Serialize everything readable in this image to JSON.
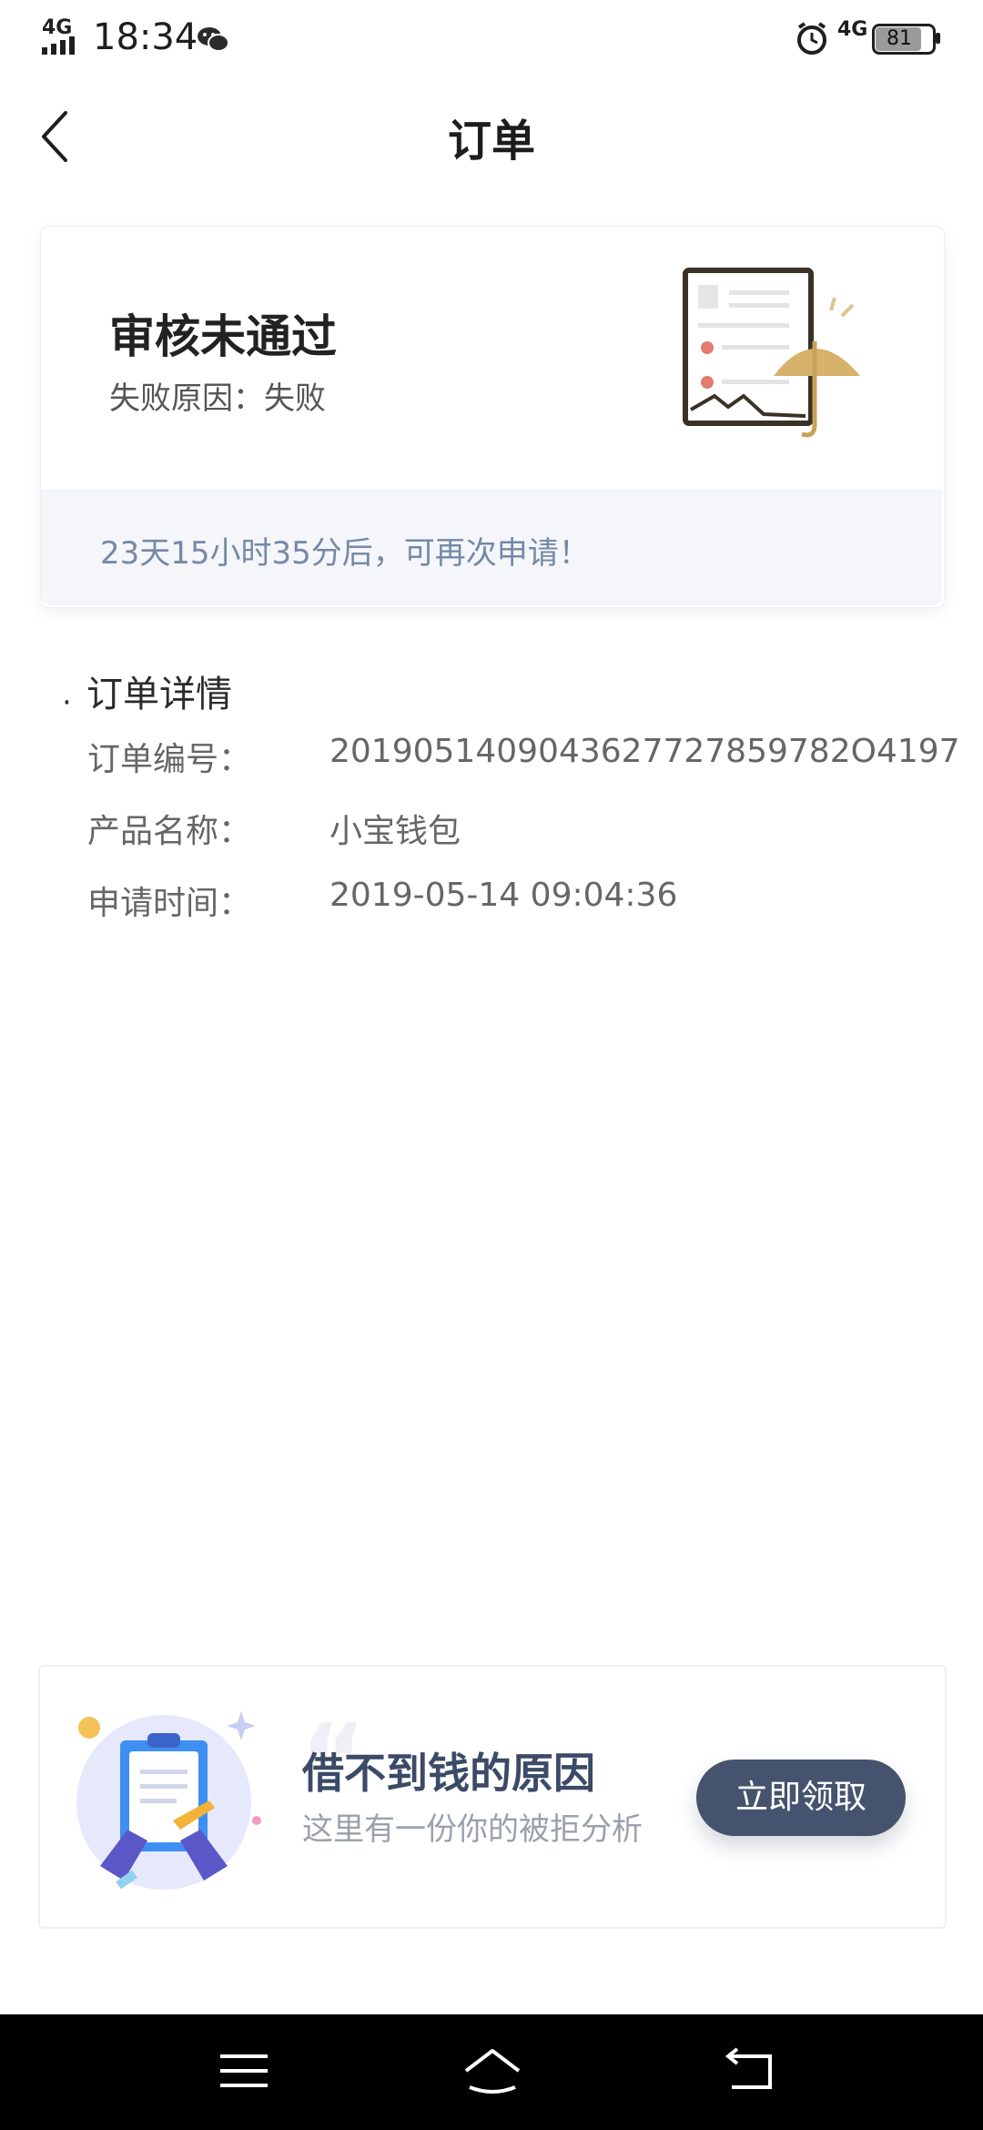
{
  "status_bar": {
    "network_left": "4G",
    "time": "18:34",
    "network_right": "4G",
    "battery": "81"
  },
  "header": {
    "title": "订单"
  },
  "status_card": {
    "title": "审核未通过",
    "reason_label": "失败原因：",
    "reason_value": "失败",
    "retry_text": "23天15小时35分后，可再次申请！"
  },
  "order_details": {
    "section_title": "订单详情",
    "rows": [
      {
        "label": "订单编号：",
        "value": "2019051409043627727859782O4197"
      },
      {
        "label": "产品名称：",
        "value": "小宝钱包"
      },
      {
        "label": "申请时间：",
        "value": "2019-05-14 09:04:36"
      }
    ]
  },
  "promo": {
    "title": "借不到钱的原因",
    "subtitle": "这里有一份你的被拒分析",
    "button_label": "立即领取"
  },
  "icons": {
    "back": "chevron-left-icon",
    "wechat": "wechat-icon",
    "alarm": "alarm-icon",
    "battery": "battery-icon",
    "menu": "menu-icon",
    "home": "home-icon",
    "back_nav": "return-icon"
  },
  "colors": {
    "retry_text": "#7688a6",
    "button_bg": "#45536e",
    "promo_title": "#3b4a66"
  }
}
